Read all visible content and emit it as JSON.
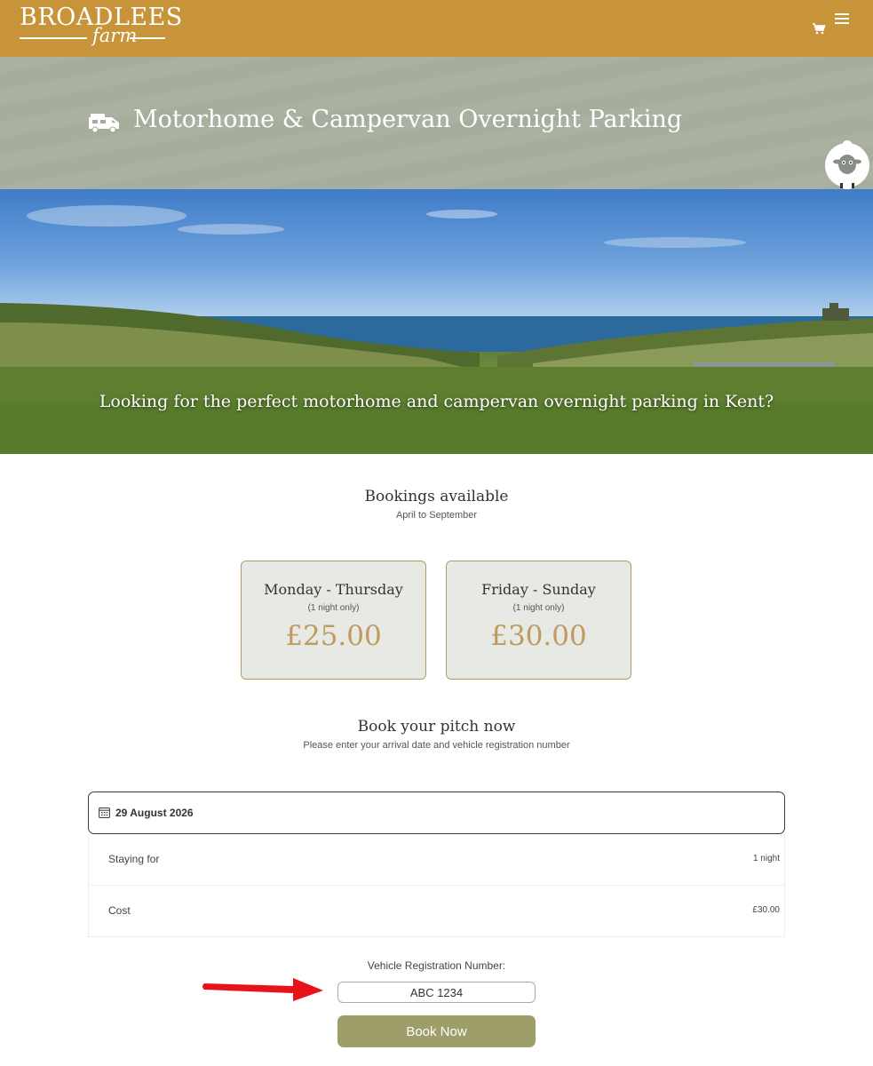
{
  "header": {
    "logo_text": "BROADLEES",
    "logo_sub": "farm",
    "cart_icon": "cart-icon",
    "menu_icon": "hamburger-menu-icon",
    "background_color": "#c8943a"
  },
  "title_band": {
    "title": "Motorhome & Campervan Overnight Parking",
    "icon": "motorhome-icon",
    "mascot_icon": "sheep-icon"
  },
  "hero": {
    "caption": "Looking for the perfect motorhome and campervan overnight parking in Kent?"
  },
  "bookings": {
    "title": "Bookings available",
    "subtitle": "April to September",
    "cards": [
      {
        "title": "Monday - Thursday",
        "note": "(1 night only)",
        "price": "£25.00"
      },
      {
        "title": "Friday - Sunday",
        "note": "(1 night only)",
        "price": "£30.00"
      }
    ]
  },
  "book_section": {
    "title": "Book your pitch now",
    "subtitle": "Please enter your arrival date and vehicle registration number"
  },
  "booking_widget": {
    "date_icon": "calendar-icon",
    "date": "29 August 2026",
    "rows": [
      {
        "label": "Staying for",
        "value": "1 night"
      },
      {
        "label": "Cost",
        "value": "£30.00"
      }
    ]
  },
  "vehicle": {
    "label": "Vehicle Registration Number:",
    "value": "ABC 1234"
  },
  "book_button": {
    "label": "Book Now",
    "color": "#9e9e6a"
  },
  "annotation": {
    "arrow_icon": "red-arrow-icon",
    "arrow_color": "#e8131a"
  }
}
